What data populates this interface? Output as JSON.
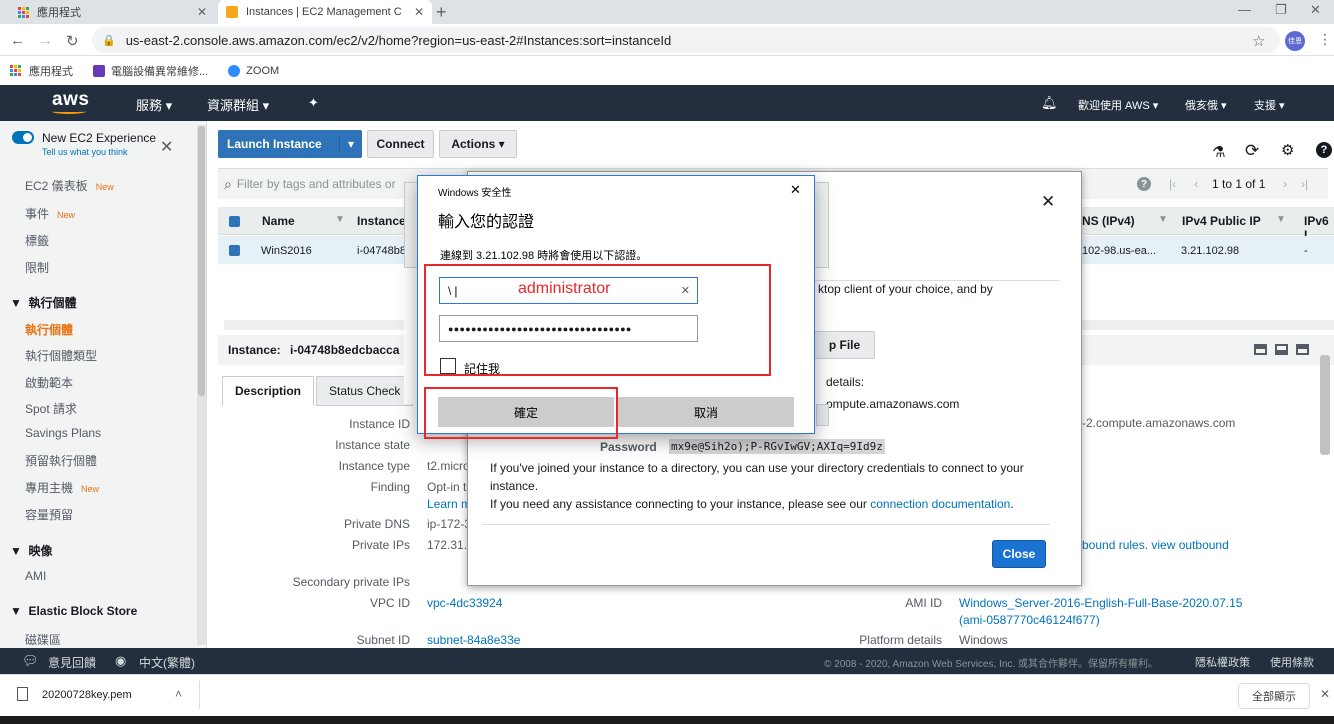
{
  "browser": {
    "tabs": [
      {
        "label": "應用程式"
      },
      {
        "label": "Instances | EC2 Management C"
      }
    ],
    "url": "us-east-2.console.aws.amazon.com/ec2/v2/home?region=us-east-2#Instances:sort=instanceId",
    "profile_label": "佳恩",
    "bookmarks": [
      {
        "label": "應用程式"
      },
      {
        "label": "電腦設備異常維修..."
      },
      {
        "label": "ZOOM"
      }
    ]
  },
  "aws_nav": {
    "logo": "aws",
    "services": "服務",
    "resource_groups": "資源群組",
    "welcome": "歡迎使用 AWS",
    "region": "俄亥俄",
    "support": "支援"
  },
  "sidebar": {
    "new_experience": "New EC2 Experience",
    "new_experience_sub": "Tell us what you think",
    "new_badge": "New",
    "items_top": [
      {
        "label": "EC2 儀表板",
        "new": true
      },
      {
        "label": "事件",
        "new": true
      },
      {
        "label": "標籤",
        "new": false
      },
      {
        "label": "限制",
        "new": false
      }
    ],
    "section_instances": "執行個體",
    "instances_items": [
      {
        "label": "執行個體",
        "new": false
      },
      {
        "label": "執行個體類型",
        "new": false
      },
      {
        "label": "啟動範本",
        "new": false
      },
      {
        "label": "Spot 請求",
        "new": false
      },
      {
        "label": "Savings Plans",
        "new": false
      },
      {
        "label": "預留執行個體",
        "new": false
      },
      {
        "label": "專用主機",
        "new": true
      },
      {
        "label": "容量預留",
        "new": false
      }
    ],
    "section_images": "映像",
    "images_items": [
      {
        "label": "AMI"
      }
    ],
    "section_ebs": "Elastic Block Store",
    "ebs_items": [
      {
        "label": "磁碟區"
      }
    ]
  },
  "toolbar": {
    "launch": "Launch Instance",
    "connect": "Connect",
    "actions": "Actions",
    "filter_placeholder": "Filter by tags and attributes or",
    "pagination": "1 to 1 of 1"
  },
  "table": {
    "headers": [
      "Name",
      "Instance",
      "NS (IPv4)",
      "IPv4 Public IP",
      "IPv6 I"
    ],
    "row": {
      "name": "WinS2016",
      "instance": "i-04748b8",
      "dns": "102-98.us-ea...",
      "public_ip": "3.21.102.98",
      "ipv6": "-"
    }
  },
  "details": {
    "instance_label": "Instance:",
    "instance_id": "i-04748b8edcbacca",
    "tabs": [
      "Description",
      "Status Check"
    ],
    "rows": [
      {
        "k": "Instance ID",
        "v": ""
      },
      {
        "k": "Instance state",
        "v": ""
      },
      {
        "k": "Instance type",
        "v": "t2.micro"
      },
      {
        "k": "Finding",
        "v": "Opt-in to"
      },
      {
        "k": "",
        "v": "Learn m"
      },
      {
        "k": "Private DNS",
        "v": "ip-172-3"
      },
      {
        "k": "Private IPs",
        "v": "172.31.3"
      },
      {
        "k": "Secondary private IPs",
        "v": ""
      },
      {
        "k": "VPC ID",
        "v": "vpc-4dc33924"
      }
    ],
    "right_dns": "-2.compute.amazonaws.com",
    "right_outbound": "bound rules. view outbound",
    "ami_label": "AMI ID",
    "ami_value": "Windows_Server-2016-English-Full-Base-2020.07.15",
    "ami_value2": "(ami-0587770c46124f677)",
    "subnet_label": "Subnet ID",
    "subnet_value": "subnet-84a8e33e",
    "platform_label": "Platform details",
    "platform_value": "Windows"
  },
  "connect_modal": {
    "close_x": "✕",
    "text1": "ktop client of your choice, and by",
    "download_btn": "p File",
    "text_details": "details:",
    "host": "ompute.amazonaws.com",
    "password_label": "Password",
    "password_value": "mx9e@Sih2o);P-RGvIwGV;AXIq=9Id9z",
    "p1": "If you've joined your instance to a directory, you can use your directory credentials to connect to your instance.",
    "p2_prefix": "If you need any assistance connecting to your instance, please see our",
    "p2_link": "connection documentation",
    "p2_suffix": ".",
    "close_btn": "Close"
  },
  "win_security": {
    "title": "Windows 安全性",
    "heading": "輸入您的認證",
    "subtitle": "連線到 3.21.102.98 時將會使用以下認證。",
    "username_value": "\\",
    "username_hint": "administrator",
    "password_masked": "●●●●●●●●●●●●●●●●●●●●●●●●●●●●●●●●",
    "remember": "記住我",
    "ok": "確定",
    "cancel": "取消"
  },
  "footer": {
    "feedback": "意見回饋",
    "language": "中文(繁體)",
    "copyright": "© 2008 - 2020, Amazon Web Services, Inc. 或其合作夥伴。保留所有權利。",
    "privacy": "隱私權政策",
    "terms": "使用條款"
  },
  "downloads": {
    "file": "20200728key.pem",
    "show_all": "全部顯示"
  }
}
